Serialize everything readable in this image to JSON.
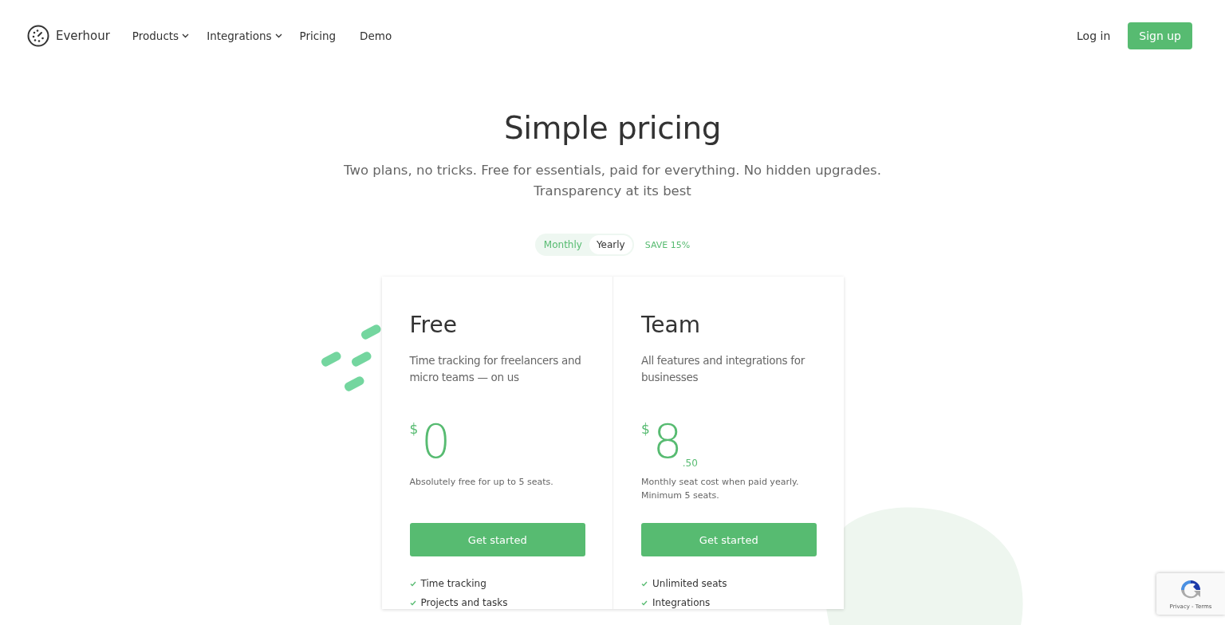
{
  "nav": {
    "brand": "Everhour",
    "links": [
      {
        "label": "Products",
        "dropdown": true
      },
      {
        "label": "Integrations",
        "dropdown": true
      },
      {
        "label": "Pricing",
        "dropdown": false
      },
      {
        "label": "Demo",
        "dropdown": false
      }
    ],
    "login": "Log in",
    "signup": "Sign up"
  },
  "hero": {
    "title": "Simple pricing",
    "subtitle_lines": [
      "Two plans, no tricks. Free for essentials, paid for everything. No hidden upgrades.",
      "Transparency at its best"
    ]
  },
  "billing": {
    "options": [
      {
        "label": "Monthly",
        "selected": false
      },
      {
        "label": "Yearly",
        "selected": true
      }
    ],
    "badge": "SAVE 15%"
  },
  "plans": [
    {
      "name": "Free",
      "description": "Time tracking for freelancers and micro teams — on us",
      "currency": "$",
      "price": "0",
      "note_lines": [
        "Absolutely free for up to 5 seats."
      ],
      "cta": "Get started",
      "features": [
        "Time tracking",
        "Projects and tasks"
      ]
    },
    {
      "name": "Team",
      "description": "All features and integrations for businesses",
      "currency": "$",
      "price": "8",
      "cents": ".50",
      "note_lines": [
        "Monthly seat cost when paid yearly.",
        "Minimum 5 seats."
      ],
      "cta": "Get started",
      "features": [
        "Unlimited seats",
        "Integrations"
      ]
    }
  ],
  "recaptcha": {
    "links": "Privacy - Terms"
  }
}
